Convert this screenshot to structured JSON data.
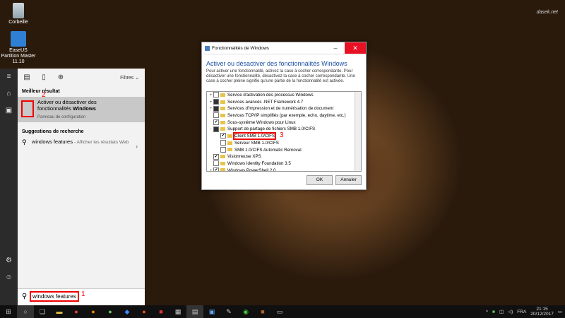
{
  "desktop": {
    "icons": [
      {
        "label": "Corbeille"
      },
      {
        "label": "EaseUS Partition Master 11.10"
      }
    ],
    "watermark": "dasek.net"
  },
  "start_menu": {
    "filters_label": "Filtres",
    "best_match_header": "Meilleur résultat",
    "best_match": {
      "title_line1": "Activer ou désactiver des",
      "title_line2": "fonctionnalités",
      "title_bold": "Windows",
      "subtitle": "Panneau de configuration",
      "annotation": "2"
    },
    "suggestions_header": "Suggestions de recherche",
    "suggestion": {
      "text": "windows features",
      "hint": "- Afficher les résultats Web"
    },
    "search_value": "windows features",
    "search_annotation": "1"
  },
  "dialog": {
    "title": "Fonctionnalités de Windows",
    "heading": "Activer ou désactiver des fonctionnalités Windows",
    "description": "Pour activer une fonctionnalité, activez la case à cocher correspondante. Pour désactiver une fonctionnalité, désactivez la case à cocher correspondante. Une case à cocher pleine signifie qu'une partie de la fonctionnalité est activée.",
    "features": [
      {
        "label": "Service d'activation des processus Windows",
        "state": "empty",
        "expand": "+",
        "level": 0
      },
      {
        "label": "Services avancés .NET Framework 4.7",
        "state": "full",
        "expand": "+",
        "level": 0
      },
      {
        "label": "Services d'impression et de numérisation de document",
        "state": "full",
        "expand": "+",
        "level": 0
      },
      {
        "label": "Services TCP/IP simplifiés (par exemple, echo, daytime, etc.)",
        "state": "empty",
        "expand": "",
        "level": 0
      },
      {
        "label": "Sous-système Windows pour Linux",
        "state": "checked",
        "expand": "",
        "level": 0
      },
      {
        "label": "Support de partage de fichiers SMB 1.0/CIFS",
        "state": "full",
        "expand": "-",
        "level": 0
      },
      {
        "label": "Client SMB 1.0/CIFS",
        "state": "checked",
        "expand": "",
        "level": 1,
        "highlight": true
      },
      {
        "label": "Serveur SMB 1.0/CIFS",
        "state": "empty",
        "expand": "",
        "level": 1
      },
      {
        "label": "SMB 1.0/CIFS Automatic Removal",
        "state": "empty",
        "expand": "",
        "level": 1
      },
      {
        "label": "Visionneuse XPS",
        "state": "checked",
        "expand": "",
        "level": 0
      },
      {
        "label": "Windows Identity Foundation 3.5",
        "state": "empty",
        "expand": "",
        "level": 0
      },
      {
        "label": "Windows PowerShell 2.0",
        "state": "checked",
        "expand": "+",
        "level": 0
      }
    ],
    "annotation": "3",
    "ok_label": "OK",
    "cancel_label": "Annuler"
  },
  "taskbar": {
    "language": "FRA",
    "time": "21:15",
    "date": "20/12/2017"
  }
}
